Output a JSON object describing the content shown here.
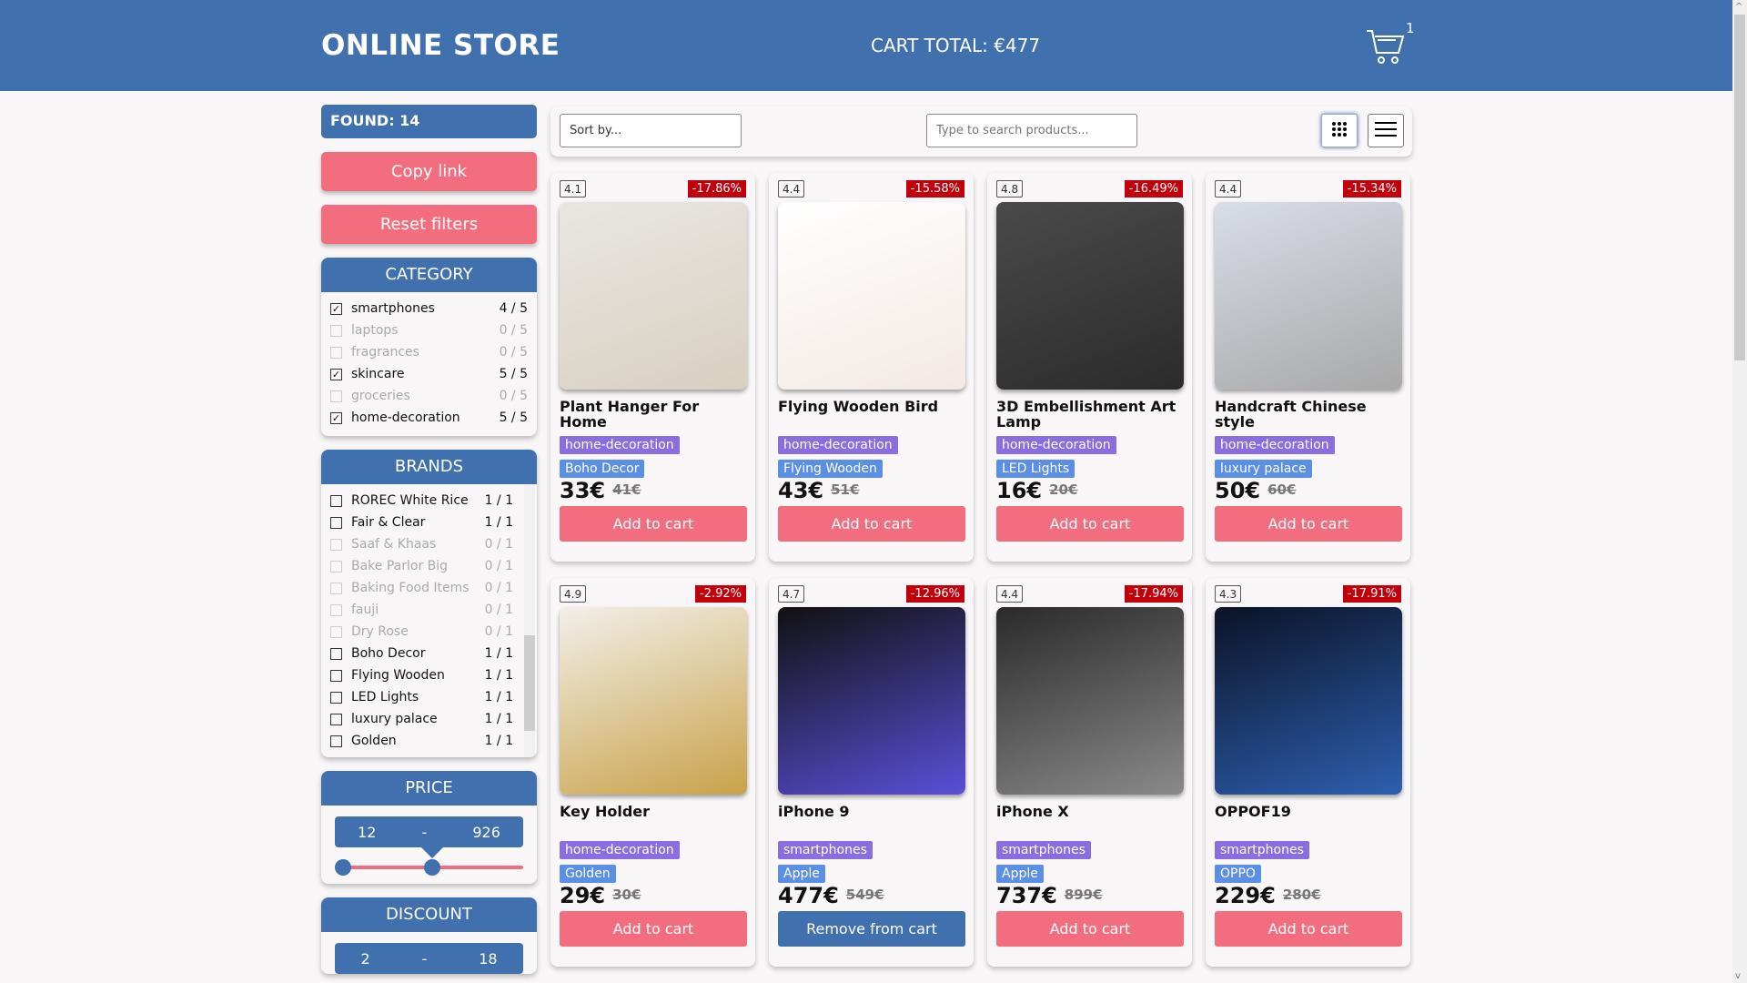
{
  "header": {
    "logo": "ONLINE STORE",
    "cart_total": "CART TOTAL: €477",
    "cart_count": "1"
  },
  "sidebar": {
    "found": "FOUND: 14",
    "copy_link": "Copy link",
    "reset": "Reset filters",
    "category": {
      "title": "CATEGORY",
      "items": [
        {
          "label": "smartphones",
          "count": "4 / 5",
          "checked": true,
          "disabled": false
        },
        {
          "label": "laptops",
          "count": "0 / 5",
          "checked": false,
          "disabled": true
        },
        {
          "label": "fragrances",
          "count": "0 / 5",
          "checked": false,
          "disabled": true
        },
        {
          "label": "skincare",
          "count": "5 / 5",
          "checked": true,
          "disabled": false
        },
        {
          "label": "groceries",
          "count": "0 / 5",
          "checked": false,
          "disabled": true
        },
        {
          "label": "home-decoration",
          "count": "5 / 5",
          "checked": true,
          "disabled": false
        }
      ]
    },
    "brands": {
      "title": "BRANDS",
      "items": [
        {
          "label": "ROREC White Rice",
          "count": "1 / 1",
          "disabled": false
        },
        {
          "label": "Fair & Clear",
          "count": "1 / 1",
          "disabled": false
        },
        {
          "label": "Saaf & Khaas",
          "count": "0 / 1",
          "disabled": true
        },
        {
          "label": "Bake Parlor Big",
          "count": "0 / 1",
          "disabled": true
        },
        {
          "label": "Baking Food Items",
          "count": "0 / 1",
          "disabled": true
        },
        {
          "label": "fauji",
          "count": "0 / 1",
          "disabled": true
        },
        {
          "label": "Dry Rose",
          "count": "0 / 1",
          "disabled": true
        },
        {
          "label": "Boho Decor",
          "count": "1 / 1",
          "disabled": false
        },
        {
          "label": "Flying Wooden",
          "count": "1 / 1",
          "disabled": false
        },
        {
          "label": "LED Lights",
          "count": "1 / 1",
          "disabled": false
        },
        {
          "label": "luxury palace",
          "count": "1 / 1",
          "disabled": false
        },
        {
          "label": "Golden",
          "count": "1 / 1",
          "disabled": false
        }
      ]
    },
    "price": {
      "title": "PRICE",
      "min": "12",
      "sep": "-",
      "max": "926"
    },
    "discount": {
      "title": "DISCOUNT",
      "min": "2",
      "sep": "-",
      "max": "18"
    }
  },
  "toolbar": {
    "sort_placeholder": "Sort by...",
    "search_placeholder": "Type to search products...",
    "view": "grid"
  },
  "products": [
    {
      "rating": "4.1",
      "discount": "-17.86%",
      "title": "Plant Hanger For Home",
      "category": "home-decoration",
      "brand": "Boho Decor",
      "price": "33€",
      "old_price": "41€",
      "button": "Add to cart",
      "in_cart": false,
      "colors": [
        "#e9e6e3",
        "#d8d0c0"
      ]
    },
    {
      "rating": "4.4",
      "discount": "-15.58%",
      "title": "Flying Wooden Bird",
      "category": "home-decoration",
      "brand": "Flying Wooden",
      "price": "43€",
      "old_price": "51€",
      "button": "Add to cart",
      "in_cart": false,
      "colors": [
        "#ffffff",
        "#f3e9e4"
      ]
    },
    {
      "rating": "4.8",
      "discount": "-16.49%",
      "title": "3D Embellishment Art Lamp",
      "category": "home-decoration",
      "brand": "LED Lights",
      "price": "16€",
      "old_price": "20€",
      "button": "Add to cart",
      "in_cart": false,
      "colors": [
        "#4a4a4a",
        "#2b2b2b"
      ]
    },
    {
      "rating": "4.4",
      "discount": "-15.34%",
      "title": "Handcraft Chinese style",
      "category": "home-decoration",
      "brand": "luxury palace",
      "price": "50€",
      "old_price": "60€",
      "button": "Add to cart",
      "in_cart": false,
      "colors": [
        "#d9dde8",
        "#a8a8a8"
      ]
    },
    {
      "rating": "4.9",
      "discount": "-2.92%",
      "title": "Key Holder",
      "category": "home-decoration",
      "brand": "Golden",
      "price": "29€",
      "old_price": "30€",
      "button": "Add to cart",
      "in_cart": false,
      "colors": [
        "#f2efe9",
        "#c9a24a"
      ]
    },
    {
      "rating": "4.7",
      "discount": "-12.96%",
      "title": "iPhone 9",
      "category": "smartphones",
      "brand": "Apple",
      "price": "477€",
      "old_price": "549€",
      "button": "Remove from cart",
      "in_cart": true,
      "colors": [
        "#111111",
        "#5a4fd8"
      ]
    },
    {
      "rating": "4.4",
      "discount": "-17.94%",
      "title": "iPhone X",
      "category": "smartphones",
      "brand": "Apple",
      "price": "737€",
      "old_price": "899€",
      "button": "Add to cart",
      "in_cart": false,
      "colors": [
        "#2a2a2a",
        "#8a8a8a"
      ]
    },
    {
      "rating": "4.3",
      "discount": "-17.91%",
      "title": "OPPOF19",
      "category": "smartphones",
      "brand": "OPPO",
      "price": "229€",
      "old_price": "280€",
      "button": "Add to cart",
      "in_cart": false,
      "colors": [
        "#0b1326",
        "#2d5fb0"
      ]
    }
  ]
}
